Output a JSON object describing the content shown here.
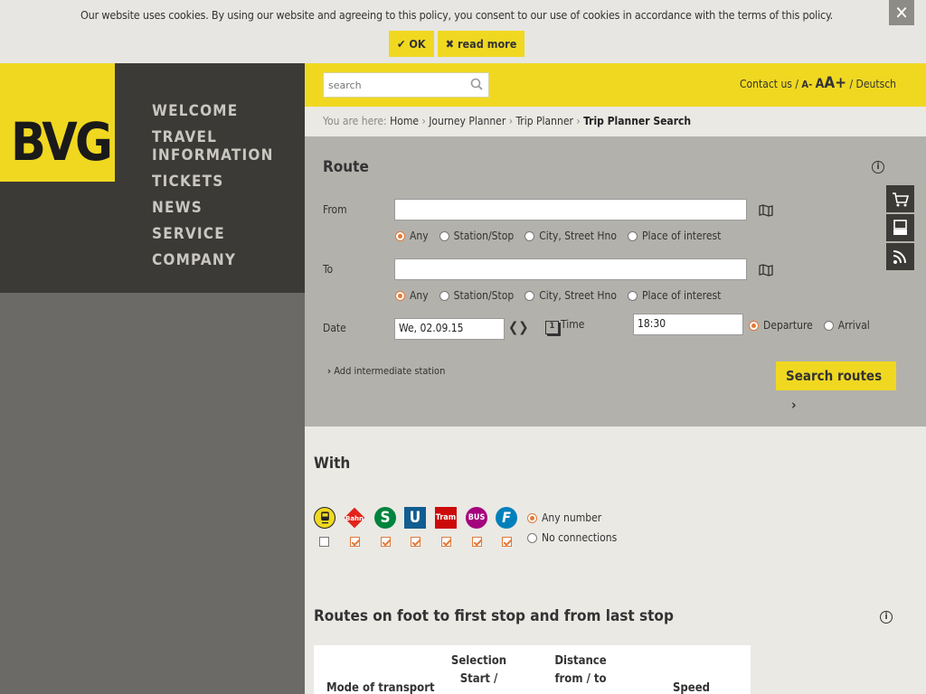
{
  "cookie": {
    "message": "Our website uses cookies. By using our website and agreeing to this policy, you consent to our use of cookies in accordance with the terms of this policy.",
    "ok_label": "OK",
    "read_more_label": "read more",
    "ok_icon": "check-icon",
    "read_more_icon": "close-x-icon"
  },
  "logo": {
    "text": "BVG"
  },
  "nav": {
    "items": [
      {
        "label": "Welcome"
      },
      {
        "label": "Travel Information"
      },
      {
        "label": "Tickets"
      },
      {
        "label": "News"
      },
      {
        "label": "Service"
      },
      {
        "label": "Company"
      }
    ]
  },
  "header": {
    "search_placeholder": "search",
    "contact": "Contact us /",
    "font_small": "A-",
    "font_mid": "A",
    "font_large": "A+",
    "lang": "/ Deutsch"
  },
  "breadcrumb": {
    "prefix": "You are here:",
    "items": [
      "Home",
      "Journey Planner",
      "Trip Planner"
    ],
    "current": "Trip Planner Search"
  },
  "route": {
    "title": "Route",
    "from_label": "From",
    "to_label": "To",
    "type_options": [
      "Any",
      "Station/Stop",
      "City, Street Hno",
      "Place of interest"
    ],
    "date_label": "Date",
    "date_value": "We, 02.09.15",
    "calendar_day": "1",
    "time_label": "Time",
    "time_value": "18:30",
    "departure_label": "Departure",
    "arrival_label": "Arrival",
    "add_station": "Add intermediate station",
    "search_button": "Search routes"
  },
  "with": {
    "title": "With",
    "modes": [
      {
        "name": "Subway",
        "icon": "subway-icon",
        "color": "#f0d821",
        "checked": false
      },
      {
        "name": "Bahn",
        "icon": "bahn-icon",
        "color": "#e2231a",
        "checked": true
      },
      {
        "name": "S",
        "icon": "s-bahn-icon",
        "color": "#00843d",
        "checked": true
      },
      {
        "name": "U",
        "icon": "u-bahn-icon",
        "color": "#115d91",
        "checked": true
      },
      {
        "name": "Tram",
        "icon": "tram-icon",
        "color": "#cc0a0a",
        "checked": true
      },
      {
        "name": "BUS",
        "icon": "bus-icon",
        "color": "#a5027d",
        "checked": true
      },
      {
        "name": "F",
        "icon": "ferry-icon",
        "color": "#0080ba",
        "checked": true
      }
    ],
    "connections": [
      "Any number",
      "No connections"
    ]
  },
  "walk": {
    "title": "Routes on foot to first stop and from last stop",
    "columns": [
      "Mode of transport",
      "Selection Start /",
      "Distance from / to",
      "Speed"
    ]
  },
  "colors": {
    "accent": "#f0d821",
    "dark": "#3b3a36",
    "radio": "#e07a3a"
  }
}
